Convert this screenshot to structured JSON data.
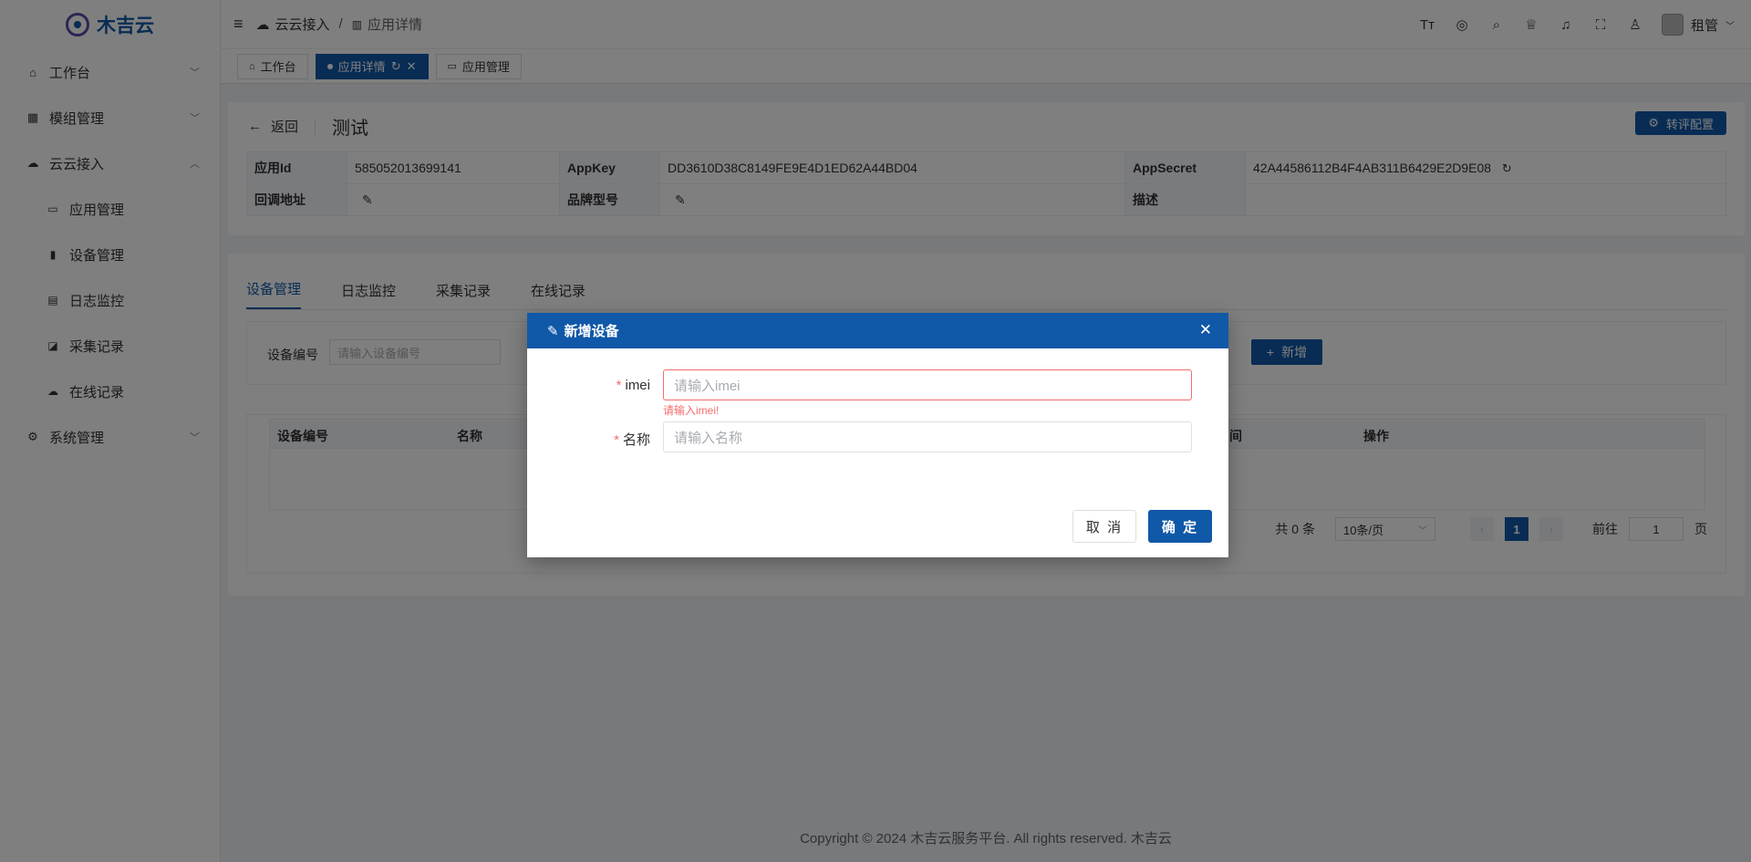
{
  "brand": {
    "name": "木吉云"
  },
  "sidebar": {
    "items": [
      {
        "label": "工作台",
        "icon": "home-icon"
      },
      {
        "label": "模组管理",
        "icon": "grid-icon"
      },
      {
        "label": "云云接入",
        "icon": "cloud-icon"
      },
      {
        "label": "系统管理",
        "icon": "gear-icon"
      }
    ],
    "subitems": [
      {
        "label": "应用管理",
        "icon": "archive-icon"
      },
      {
        "label": "设备管理",
        "icon": "device-icon"
      },
      {
        "label": "日志监控",
        "icon": "log-icon"
      },
      {
        "label": "采集记录",
        "icon": "chart-icon"
      },
      {
        "label": "在线记录",
        "icon": "cloud-online-icon"
      }
    ]
  },
  "header": {
    "breadcrumb": [
      "云云接入",
      "应用详情"
    ],
    "user": "租管"
  },
  "tags": [
    "工作台",
    "应用详情",
    "应用管理"
  ],
  "detail": {
    "back": "返回",
    "title": "测试",
    "config_button": "转评配置",
    "labels": [
      "应用Id",
      "AppKey",
      "AppSecret",
      "回调地址",
      "品牌型号",
      "描述"
    ],
    "app_id": "585052013699141",
    "app_key": "DD3610D38C8149FE9E4D1ED62A44BD04",
    "app_secret": "42A44586112B4F4AB311B6429E2D9E08"
  },
  "tabs": [
    "设备管理",
    "日志监控",
    "采集记录",
    "在线记录"
  ],
  "search": {
    "label": "设备编号",
    "placeholder": "请输入设备编号",
    "add_button": "新增"
  },
  "table": {
    "headers": [
      "设备编号",
      "名称",
      "间",
      "操作"
    ]
  },
  "pagination": {
    "total": "共 0 条",
    "page_size": "10条/页",
    "current": "1",
    "goto": "前往",
    "goto_value": "1",
    "page_unit": "页"
  },
  "footer": "Copyright © 2024 木吉云服务平台. All rights reserved. 木吉云",
  "modal": {
    "title": "新增设备",
    "imei_label": "imei",
    "imei_placeholder": "请输入imei",
    "imei_error": "请输入imei!",
    "name_label": "名称",
    "name_placeholder": "请输入名称",
    "cancel": "取 消",
    "ok": "确 定"
  }
}
